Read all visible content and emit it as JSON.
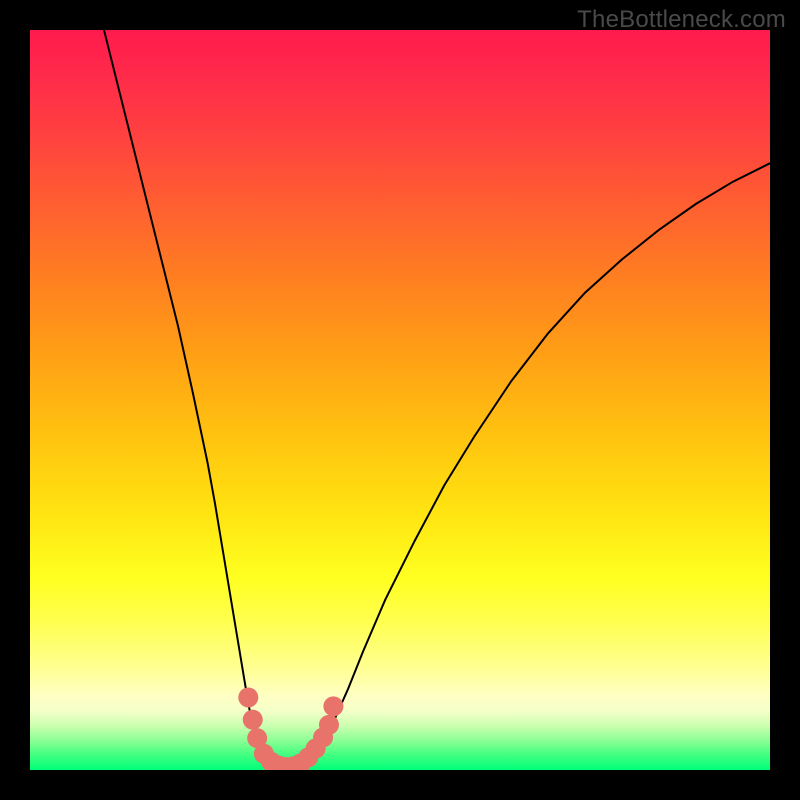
{
  "watermark": {
    "text": "TheBottleneck.com"
  },
  "chart_data": {
    "type": "line",
    "title": "",
    "xlabel": "",
    "ylabel": "",
    "xlim": [
      0,
      100
    ],
    "ylim": [
      0,
      100
    ],
    "grid": false,
    "curve": [
      {
        "x": 10.0,
        "y": 100.0
      },
      {
        "x": 12.0,
        "y": 92.0
      },
      {
        "x": 14.0,
        "y": 84.0
      },
      {
        "x": 16.0,
        "y": 76.0
      },
      {
        "x": 18.0,
        "y": 68.0
      },
      {
        "x": 20.0,
        "y": 60.0
      },
      {
        "x": 22.0,
        "y": 51.0
      },
      {
        "x": 24.0,
        "y": 41.5
      },
      {
        "x": 25.0,
        "y": 36.0
      },
      {
        "x": 26.0,
        "y": 30.0
      },
      {
        "x": 27.0,
        "y": 24.0
      },
      {
        "x": 28.0,
        "y": 18.0
      },
      {
        "x": 28.5,
        "y": 15.0
      },
      {
        "x": 29.0,
        "y": 12.0
      },
      {
        "x": 29.5,
        "y": 9.0
      },
      {
        "x": 30.0,
        "y": 6.5
      },
      {
        "x": 30.5,
        "y": 4.5
      },
      {
        "x": 31.0,
        "y": 3.0
      },
      {
        "x": 32.0,
        "y": 1.5
      },
      {
        "x": 33.0,
        "y": 0.8
      },
      {
        "x": 34.0,
        "y": 0.4
      },
      {
        "x": 35.0,
        "y": 0.2
      },
      {
        "x": 36.0,
        "y": 0.3
      },
      {
        "x": 37.0,
        "y": 0.8
      },
      {
        "x": 38.0,
        "y": 1.6
      },
      {
        "x": 39.0,
        "y": 2.8
      },
      {
        "x": 40.0,
        "y": 4.5
      },
      {
        "x": 41.0,
        "y": 6.5
      },
      {
        "x": 43.0,
        "y": 11.0
      },
      {
        "x": 45.0,
        "y": 16.0
      },
      {
        "x": 48.0,
        "y": 23.0
      },
      {
        "x": 52.0,
        "y": 31.0
      },
      {
        "x": 56.0,
        "y": 38.5
      },
      {
        "x": 60.0,
        "y": 45.0
      },
      {
        "x": 65.0,
        "y": 52.5
      },
      {
        "x": 70.0,
        "y": 59.0
      },
      {
        "x": 75.0,
        "y": 64.5
      },
      {
        "x": 80.0,
        "y": 69.0
      },
      {
        "x": 85.0,
        "y": 73.0
      },
      {
        "x": 90.0,
        "y": 76.5
      },
      {
        "x": 95.0,
        "y": 79.5
      },
      {
        "x": 100.0,
        "y": 82.0
      }
    ],
    "dots": [
      {
        "x": 29.5,
        "y": 9.8
      },
      {
        "x": 30.1,
        "y": 6.8
      },
      {
        "x": 30.7,
        "y": 4.3
      },
      {
        "x": 31.6,
        "y": 2.2
      },
      {
        "x": 32.6,
        "y": 1.1
      },
      {
        "x": 33.6,
        "y": 0.6
      },
      {
        "x": 34.6,
        "y": 0.4
      },
      {
        "x": 35.6,
        "y": 0.5
      },
      {
        "x": 36.6,
        "y": 0.9
      },
      {
        "x": 37.6,
        "y": 1.7
      },
      {
        "x": 38.6,
        "y": 2.9
      },
      {
        "x": 39.6,
        "y": 4.4
      },
      {
        "x": 40.4,
        "y": 6.1
      },
      {
        "x": 41.0,
        "y": 8.6
      }
    ],
    "dot_color": "#e8736b",
    "curve_color": "#000000",
    "curve_width": 2
  }
}
